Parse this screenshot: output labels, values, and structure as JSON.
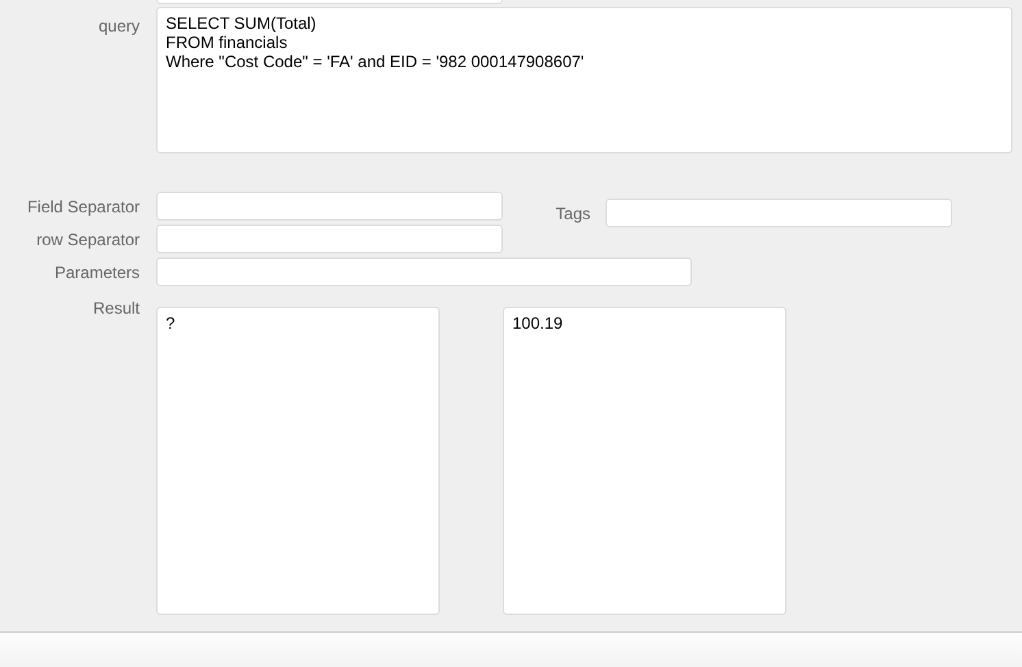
{
  "query": {
    "label": "query",
    "value": "SELECT SUM(Total)\nFROM financials\nWhere \"Cost Code\" = 'FA' and EID = '982 000147908607'"
  },
  "field_separator": {
    "label": "Field Separator"
  },
  "tags": {
    "label": "Tags"
  },
  "row_separator": {
    "label": "row Separator"
  },
  "parameters": {
    "label": "Parameters"
  },
  "result": {
    "label": "Result",
    "values": [
      "?",
      "100.19"
    ]
  }
}
